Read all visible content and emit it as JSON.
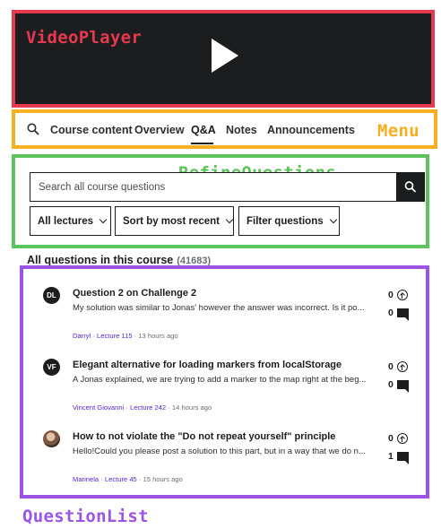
{
  "annotations": {
    "video_player": "VideoPlayer",
    "menu": "Menu",
    "refine_questions": "RefineQuestions",
    "question_list": "QuestionList"
  },
  "colors": {
    "video_player": "#e8384f",
    "menu": "#f5b021",
    "refine_questions": "#5cc45a",
    "question_list": "#9c54e6",
    "link": "#5624d0"
  },
  "menu": {
    "search_icon": "search-icon",
    "tabs": [
      {
        "label": "Course content",
        "active": false
      },
      {
        "label": "Overview",
        "active": false
      },
      {
        "label": "Q&A",
        "active": true
      },
      {
        "label": "Notes",
        "active": false
      },
      {
        "label": "Announcements",
        "active": false
      }
    ]
  },
  "refine": {
    "search_placeholder": "Search all course questions",
    "filters": [
      {
        "label": "All lectures"
      },
      {
        "label": "Sort by most recent"
      },
      {
        "label": "Filter questions"
      }
    ]
  },
  "questions_heading": {
    "title": "All questions in this course",
    "count": "(41683)"
  },
  "questions": [
    {
      "avatar": "DL",
      "title": "Question 2 on Challenge 2",
      "body": "My solution was similar to Jonas' however the answer was incorrect. Is it po...",
      "author": "Darryl",
      "lecture": "Lecture 115",
      "time": "13 hours ago",
      "upvotes": "0",
      "replies": "0"
    },
    {
      "avatar": "VF",
      "title": "Elegant alternative for loading markers from localStorage",
      "body": "A Jonas explained, we are trying to add a marker to the map right at the beg...",
      "author": "Vincent Giovanni",
      "lecture": "Lecture 242",
      "time": "14 hours ago",
      "upvotes": "0",
      "replies": "0"
    },
    {
      "avatar": "",
      "title": "How to not violate the \"Do not repeat yourself\" principle",
      "body": "Hello!Could you please post a solution to this part, but in a way that we do n...",
      "author": "Marinela",
      "lecture": "Lecture 45",
      "time": "15 hours ago",
      "upvotes": "0",
      "replies": "1"
    }
  ]
}
